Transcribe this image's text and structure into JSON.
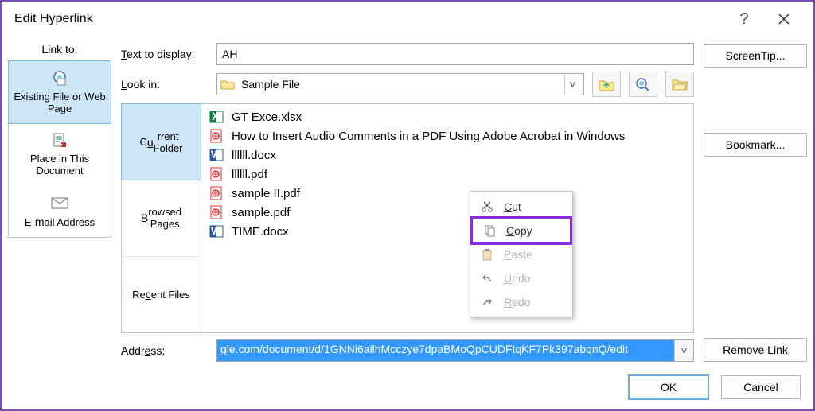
{
  "window": {
    "title": "Edit Hyperlink"
  },
  "linkto": {
    "label": "Link to:",
    "items": [
      {
        "label": "Existing File or Web Page",
        "selected": true
      },
      {
        "label": "Place in This Document",
        "selected": false
      },
      {
        "label": "E-mail Address",
        "selected": false
      }
    ]
  },
  "text_to_display": {
    "label": "Text to display:",
    "value": "AH"
  },
  "lookin": {
    "label": "Look in:",
    "folder_name": "Sample File"
  },
  "browse_nav": {
    "items": [
      {
        "label": "Current Folder",
        "selected": true
      },
      {
        "label": "Browsed Pages",
        "selected": false
      },
      {
        "label": "Recent Files",
        "selected": false
      }
    ]
  },
  "files": [
    {
      "name": "GT Exce.xlsx",
      "type": "xlsx"
    },
    {
      "name": "How to Insert Audio Comments in a PDF Using Adobe Acrobat in Windows",
      "type": "pdf"
    },
    {
      "name": "llllll.docx",
      "type": "docx"
    },
    {
      "name": "llllll.pdf",
      "type": "pdf"
    },
    {
      "name": "sample II.pdf",
      "type": "pdf"
    },
    {
      "name": "sample.pdf",
      "type": "pdf"
    },
    {
      "name": "TIME.docx",
      "type": "docx"
    }
  ],
  "address": {
    "label": "Address:",
    "value": "gle.com/document/d/1GNNi6ailhMcczye7dpaBMoQpCUDFtqKF7Pk397abqnQ/edit"
  },
  "buttons": {
    "screentip": "ScreenTip...",
    "bookmark": "Bookmark...",
    "remove_link": "Remove Link",
    "ok": "OK",
    "cancel": "Cancel"
  },
  "context_menu": {
    "items": [
      {
        "cmd": "cut",
        "label": "Cut",
        "enabled": true,
        "highlight": false
      },
      {
        "cmd": "copy",
        "label": "Copy",
        "enabled": true,
        "highlight": true
      },
      {
        "cmd": "paste",
        "label": "Paste",
        "enabled": false,
        "highlight": false
      },
      {
        "cmd": "undo",
        "label": "Undo",
        "enabled": false,
        "highlight": false
      },
      {
        "cmd": "redo",
        "label": "Redo",
        "enabled": false,
        "highlight": false
      }
    ]
  }
}
